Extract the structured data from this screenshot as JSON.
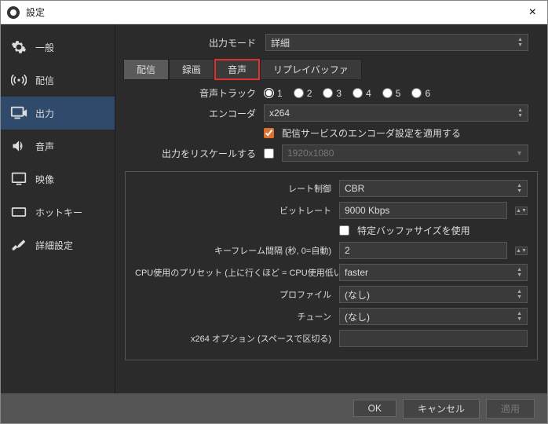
{
  "titlebar": {
    "title": "設定",
    "close": "×"
  },
  "sidebar": {
    "items": [
      {
        "label": "一般"
      },
      {
        "label": "配信"
      },
      {
        "label": "出力"
      },
      {
        "label": "音声"
      },
      {
        "label": "映像"
      },
      {
        "label": "ホットキー"
      },
      {
        "label": "詳細設定"
      }
    ]
  },
  "top": {
    "mode_label": "出力モード",
    "mode_value": "詳細"
  },
  "tabs": {
    "t0": "配信",
    "t1": "録画",
    "t2": "音声",
    "t3": "リプレイバッファ"
  },
  "form": {
    "track_label": "音声トラック",
    "track_options": {
      "o1": "1",
      "o2": "2",
      "o3": "3",
      "o4": "4",
      "o5": "5",
      "o6": "6"
    },
    "encoder_label": "エンコーダ",
    "encoder_value": "x264",
    "apply_enc_label": "配信サービスのエンコーダ設定を適用する",
    "rescale_label": "出力をリスケールする",
    "rescale_value": "1920x1080"
  },
  "box": {
    "rate_label": "レート制御",
    "rate_value": "CBR",
    "bitrate_label": "ビットレート",
    "bitrate_value": "9000 Kbps",
    "buffer_label": "特定バッファサイズを使用",
    "keyframe_label": "キーフレーム間隔 (秒, 0=自動)",
    "keyframe_value": "2",
    "cpu_label": "CPU使用のプリセット (上に行くほど = CPU使用低い)",
    "cpu_value": "faster",
    "profile_label": "プロファイル",
    "profile_value": "(なし)",
    "tune_label": "チューン",
    "tune_value": "(なし)",
    "opts_label": "x264 オプション (スペースで区切る)",
    "opts_value": ""
  },
  "footer": {
    "ok": "OK",
    "cancel": "キャンセル",
    "apply": "適用"
  }
}
